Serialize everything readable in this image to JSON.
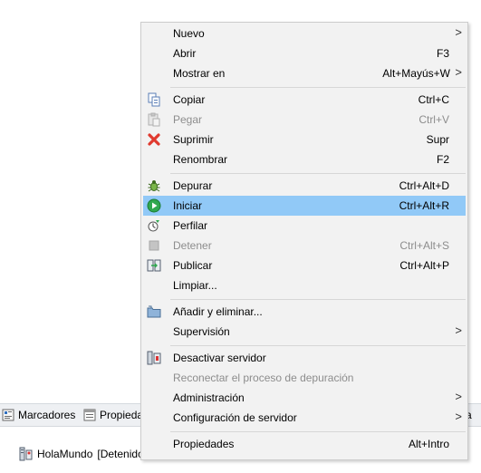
{
  "menu": {
    "nuevo": {
      "label": "Nuevo",
      "arrow": ">"
    },
    "abrir": {
      "label": "Abrir",
      "shortcut": "F3"
    },
    "mostrar_en": {
      "label": "Mostrar en",
      "shortcut": "Alt+Mayús+W",
      "arrow": ">"
    },
    "copiar": {
      "label": "Copiar",
      "shortcut": "Ctrl+C"
    },
    "pegar": {
      "label": "Pegar",
      "shortcut": "Ctrl+V"
    },
    "suprimir": {
      "label": "Suprimir",
      "shortcut": "Supr"
    },
    "renombrar": {
      "label": "Renombrar",
      "shortcut": "F2"
    },
    "depurar": {
      "label": "Depurar",
      "shortcut": "Ctrl+Alt+D"
    },
    "iniciar": {
      "label": "Iniciar",
      "shortcut": "Ctrl+Alt+R"
    },
    "perfilar": {
      "label": "Perfilar"
    },
    "detener": {
      "label": "Detener",
      "shortcut": "Ctrl+Alt+S"
    },
    "publicar": {
      "label": "Publicar",
      "shortcut": "Ctrl+Alt+P"
    },
    "limpiar": {
      "label": "Limpiar..."
    },
    "anadir_eliminar": {
      "label": "Añadir y eliminar..."
    },
    "supervision": {
      "label": "Supervisión",
      "arrow": ">"
    },
    "desactivar_servidor": {
      "label": "Desactivar servidor"
    },
    "reconectar": {
      "label": "Reconectar el proceso de depuración"
    },
    "administracion": {
      "label": "Administración",
      "arrow": ">"
    },
    "configuracion_servidor": {
      "label": "Configuración de servidor",
      "arrow": ">"
    },
    "propiedades": {
      "label": "Propiedades",
      "shortcut": "Alt+Intro"
    }
  },
  "tabs": {
    "marcadores": "Marcadores",
    "propiedades": "Propieda",
    "right": "ra"
  },
  "server": {
    "name": "HolaMundo",
    "status": "[Detenido]"
  },
  "colors": {
    "selection": "#91c9f7",
    "menu_bg": "#f2f2f2",
    "disabled_text": "#8d8d8d",
    "delete_red": "#e03a2f",
    "run_green": "#2fa84f"
  }
}
